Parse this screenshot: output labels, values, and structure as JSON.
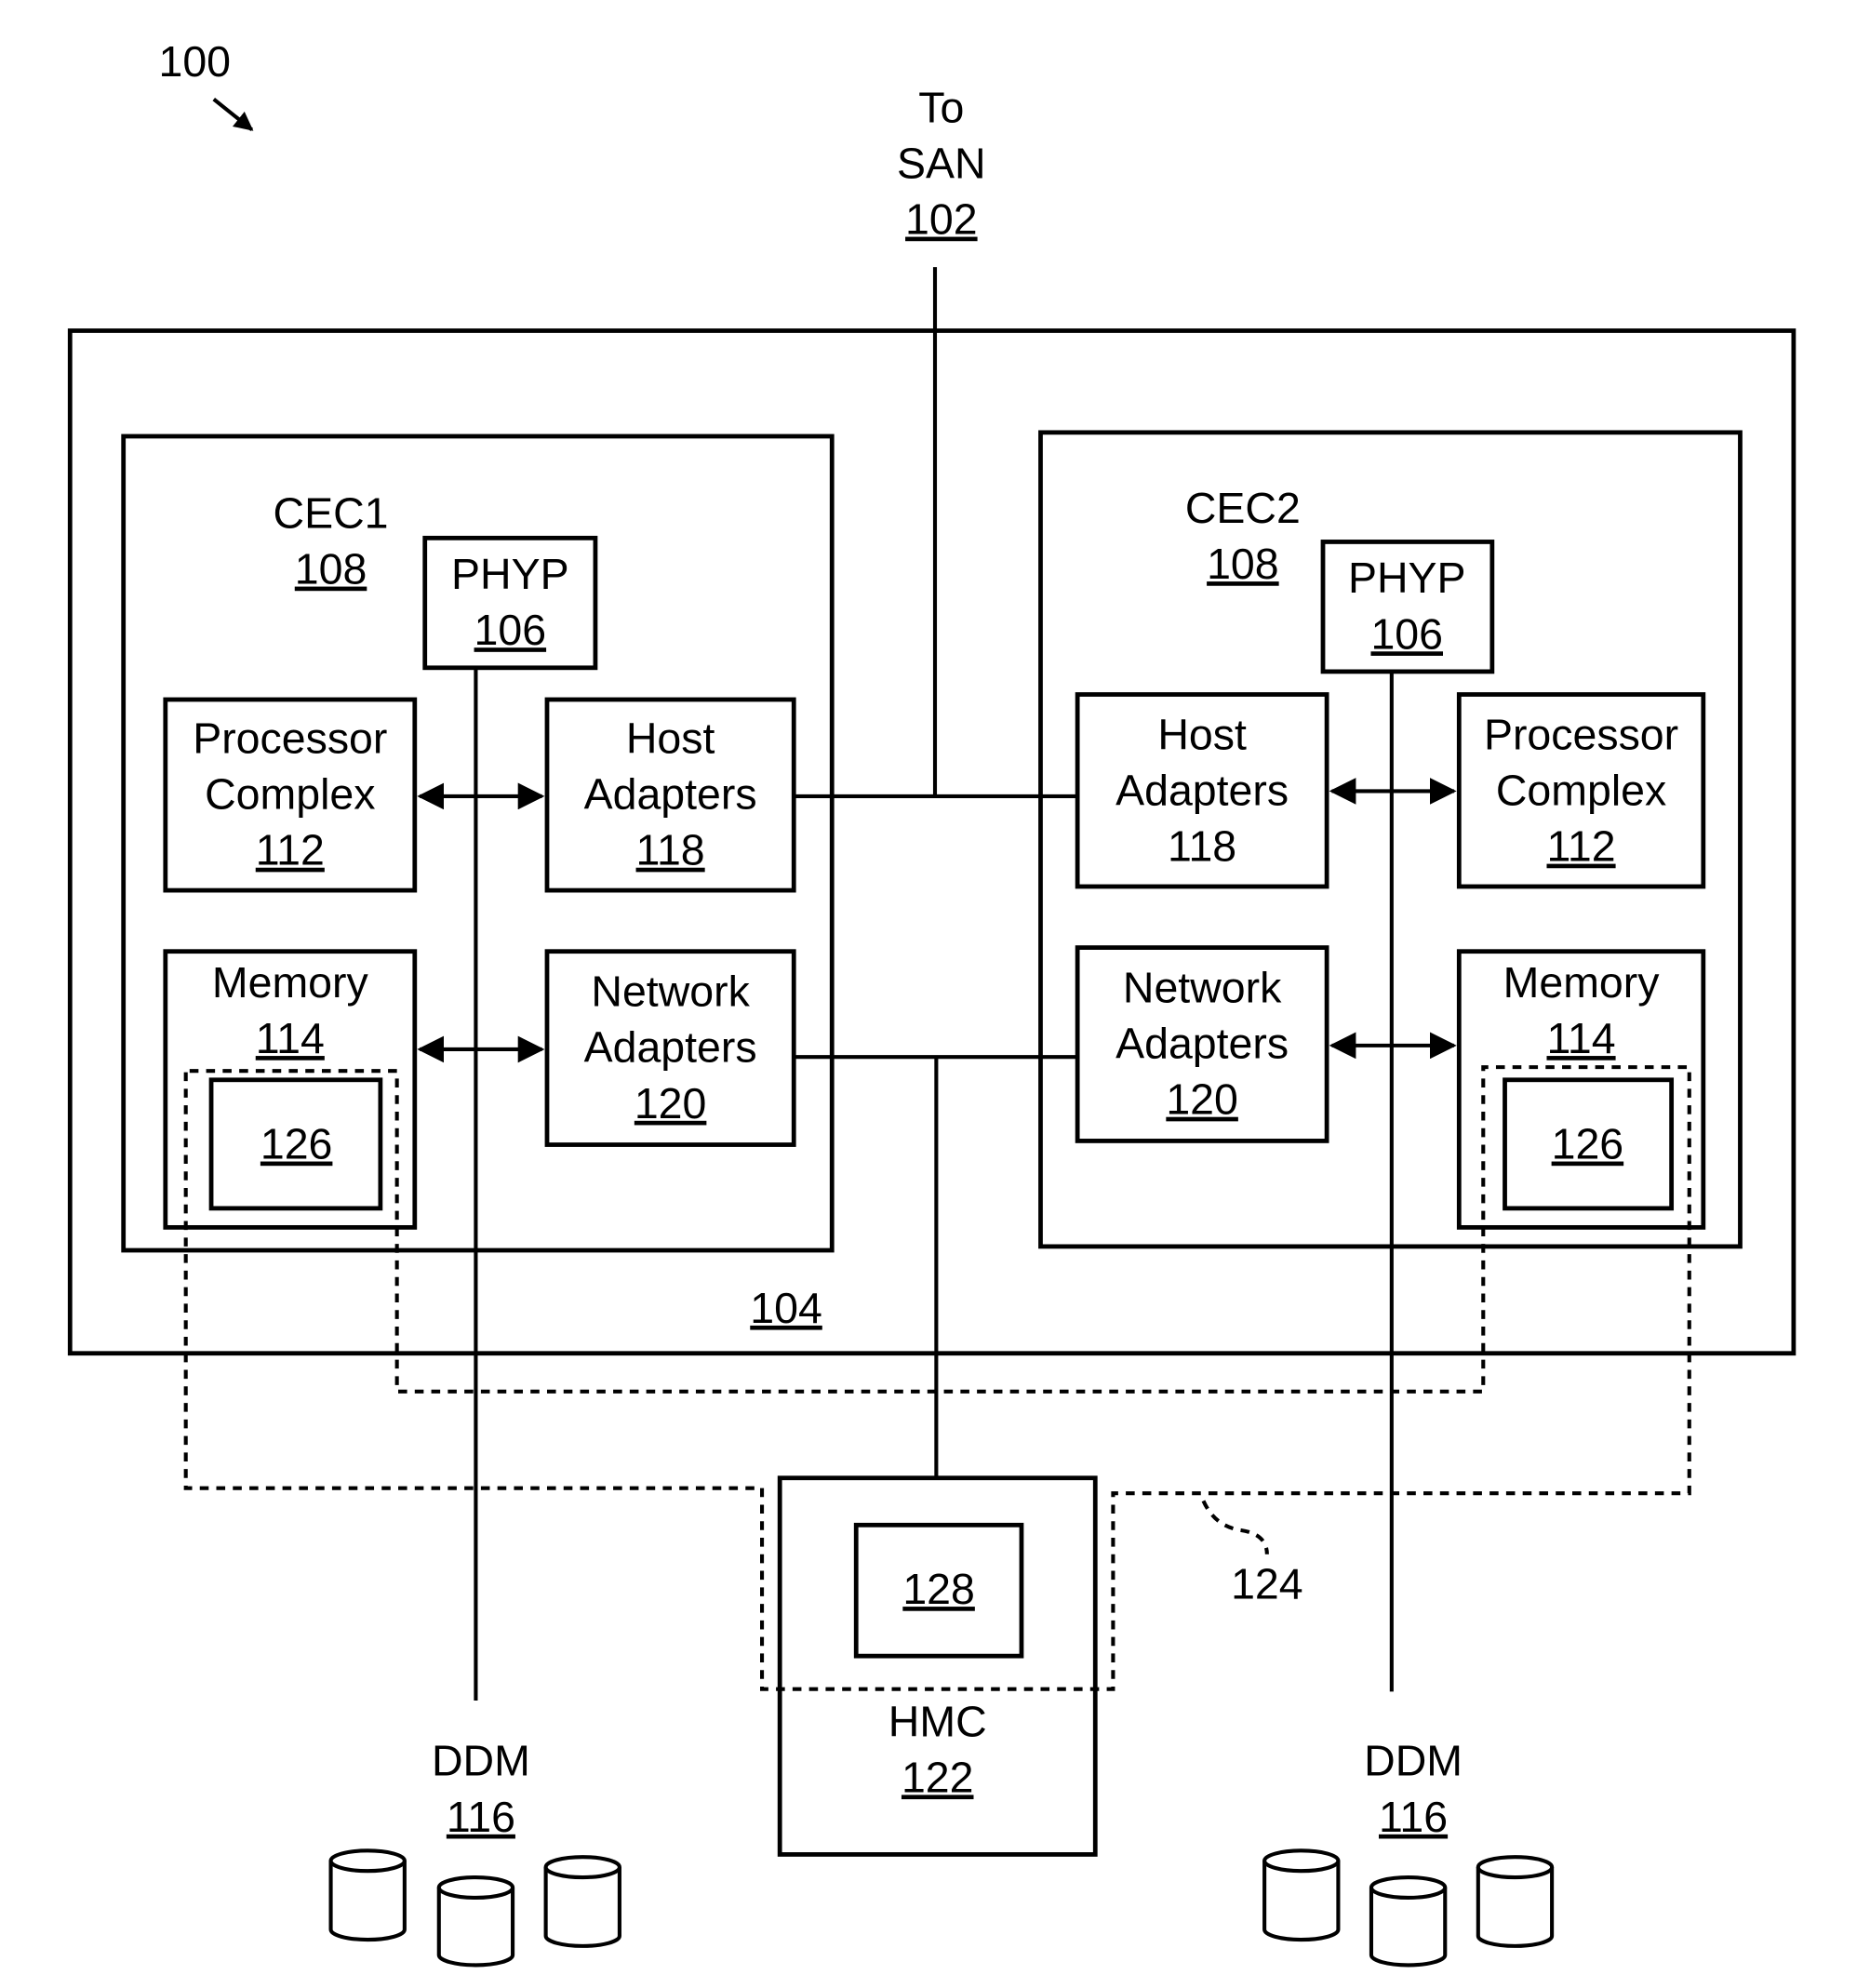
{
  "figure": {
    "ref": "100",
    "san": {
      "line1": "To",
      "line2": "SAN",
      "ref": "102"
    },
    "enclosure": {
      "ref": "104"
    },
    "cec1": {
      "title": "CEC1",
      "ref": "108",
      "phyp": {
        "label": "PHYP",
        "ref": "106"
      },
      "processor": {
        "line1": "Processor",
        "line2": "Complex",
        "ref": "112"
      },
      "host": {
        "line1": "Host",
        "line2": "Adapters",
        "ref": "118"
      },
      "memory": {
        "label": "Memory",
        "ref": "114",
        "inner_ref": "126"
      },
      "network": {
        "line1": "Network",
        "line2": "Adapters",
        "ref": "120"
      }
    },
    "cec2": {
      "title": "CEC2",
      "ref": "108",
      "phyp": {
        "label": "PHYP",
        "ref": "106"
      },
      "processor": {
        "line1": "Processor",
        "line2": "Complex",
        "ref": "112"
      },
      "host": {
        "line1": "Host",
        "line2": "Adapters",
        "ref": "118"
      },
      "memory": {
        "label": "Memory",
        "ref": "114",
        "inner_ref": "126"
      },
      "network": {
        "line1": "Network",
        "line2": "Adapters",
        "ref": "120"
      }
    },
    "hmc": {
      "label": "HMC",
      "ref": "122",
      "inner_ref": "128"
    },
    "link_ref": "124",
    "ddm_left": {
      "label": "DDM",
      "ref": "116"
    },
    "ddm_right": {
      "label": "DDM",
      "ref": "116"
    }
  }
}
